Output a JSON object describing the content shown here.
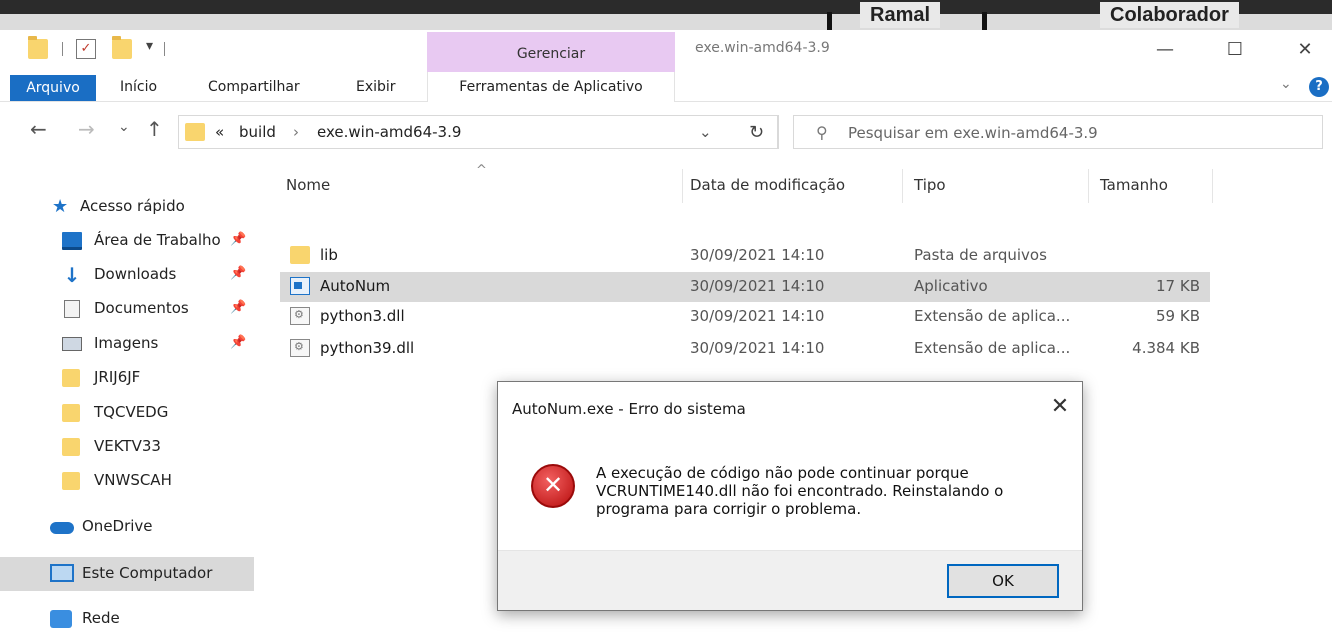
{
  "background": {
    "headers": [
      "Ramal",
      "Colaborador"
    ]
  },
  "titlebar": {
    "manage_tab": "Gerenciar",
    "window_title": "exe.win-amd64-3.9",
    "minimize": "—",
    "maximize": "☐",
    "close": "✕"
  },
  "ribbon": {
    "tabs": [
      "Arquivo",
      "Início",
      "Compartilhar",
      "Exibir",
      "Ferramentas de Aplicativo"
    ],
    "accent": "#1a6ec4",
    "manage_color": "#e8c9f2"
  },
  "nav": {
    "back": "←",
    "forward": "→",
    "recent": "⌄",
    "up": "↑",
    "overflow": "«",
    "breadcrumb": [
      "build",
      "exe.win-amd64-3.9"
    ],
    "separator": "›",
    "dropdown": "⌄",
    "refresh": "↻",
    "search_icon": "⚲",
    "search_placeholder": "Pesquisar em exe.win-amd64-3.9"
  },
  "sidebar": {
    "pin": "📌",
    "items": [
      {
        "label": "Acesso rápido",
        "icon": "star-icon"
      },
      {
        "label": "Área de Trabalho",
        "icon": "desktop-icon",
        "pinned": true
      },
      {
        "label": "Downloads",
        "icon": "download-icon",
        "pinned": true
      },
      {
        "label": "Documentos",
        "icon": "documents-icon",
        "pinned": true
      },
      {
        "label": "Imagens",
        "icon": "pictures-icon",
        "pinned": true
      },
      {
        "label": "JRIJ6JF",
        "icon": "folder-icon"
      },
      {
        "label": "TQCVEDG",
        "icon": "folder-icon"
      },
      {
        "label": "VEKTV33",
        "icon": "folder-icon"
      },
      {
        "label": "VNWSCAH",
        "icon": "folder-icon"
      },
      {
        "label": "OneDrive",
        "icon": "cloud-icon"
      },
      {
        "label": "Este Computador",
        "icon": "computer-icon",
        "selected": true
      },
      {
        "label": "Rede",
        "icon": "network-icon"
      }
    ]
  },
  "files": {
    "sort_indicator": "^",
    "columns": [
      "Nome",
      "Data de modificação",
      "Tipo",
      "Tamanho"
    ],
    "rows": [
      {
        "name": "lib",
        "date": "30/09/2021 14:10",
        "type": "Pasta de arquivos",
        "size": "",
        "icon": "folder-icon"
      },
      {
        "name": "AutoNum",
        "date": "30/09/2021 14:10",
        "type": "Aplicativo",
        "size": "17 KB",
        "icon": "application-icon",
        "selected": true
      },
      {
        "name": "python3.dll",
        "date": "30/09/2021 14:10",
        "type": "Extensão de aplica...",
        "size": "59 KB",
        "icon": "dll-icon"
      },
      {
        "name": "python39.dll",
        "date": "30/09/2021 14:10",
        "type": "Extensão de aplica...",
        "size": "4.384 KB",
        "icon": "dll-icon"
      }
    ]
  },
  "dialog": {
    "title": "AutoNum.exe - Erro do sistema",
    "close": "✕",
    "error_glyph": "✕",
    "message": "A execução de código não pode continuar porque\nVCRUNTIME140.dll não foi encontrado. Reinstalando o\nprograma para corrigir o problema.",
    "ok_label": "OK"
  }
}
